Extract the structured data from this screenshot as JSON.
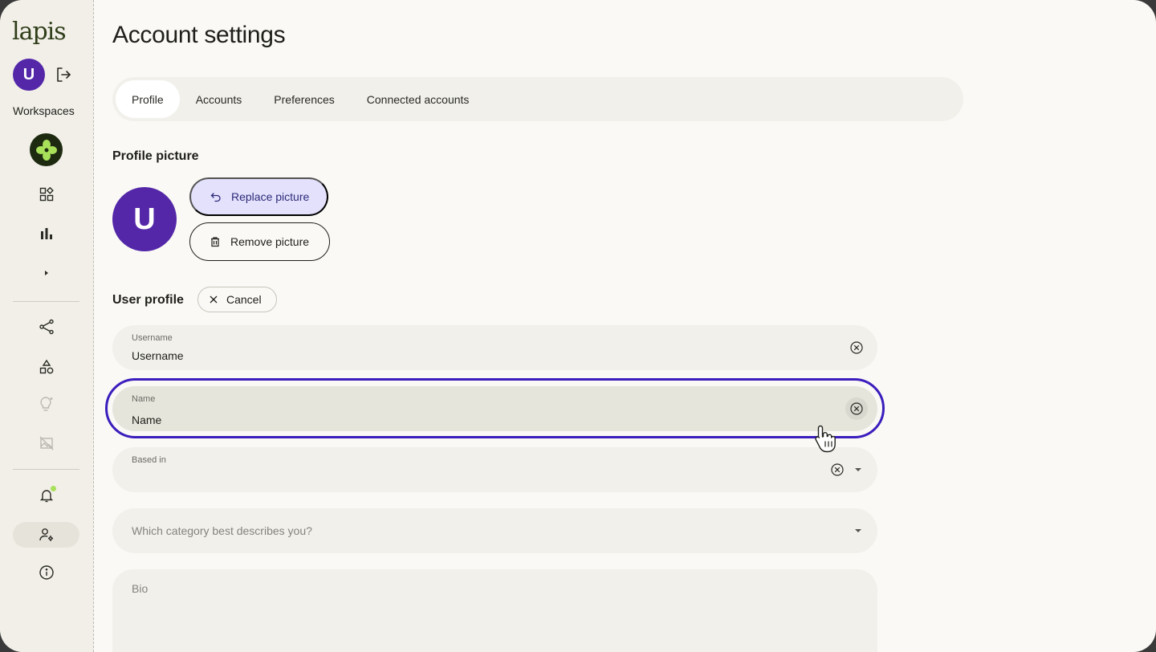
{
  "sidebar": {
    "logo": "lapis",
    "user_initial": "U",
    "workspaces_label": "Workspaces",
    "icons": [
      "logout-icon",
      "workspace-logo",
      "apps-icon",
      "bar-chart-icon",
      "chevron-right-icon",
      "share-icon",
      "shapes-icon",
      "lightbulb-icon",
      "image-slash-icon",
      "bell-icon",
      "user-settings-icon",
      "info-icon"
    ],
    "colors": {
      "avatar": "#5327a8",
      "workspace": "#1e2a10",
      "notification_dot": "#a8e05a"
    }
  },
  "page": {
    "title": "Account settings"
  },
  "tabs": [
    {
      "label": "Profile",
      "active": true
    },
    {
      "label": "Accounts",
      "active": false
    },
    {
      "label": "Preferences",
      "active": false
    },
    {
      "label": "Connected accounts",
      "active": false
    }
  ],
  "profile_picture": {
    "title": "Profile picture",
    "initial": "U",
    "replace_label": "Replace picture",
    "remove_label": "Remove picture"
  },
  "user_profile": {
    "title": "User profile",
    "cancel_label": "Cancel",
    "username": {
      "label": "Username",
      "value": "Username"
    },
    "name": {
      "label": "Name",
      "value": "Name"
    },
    "based_in": {
      "label": "Based in",
      "value": ""
    },
    "category": {
      "placeholder": "Which category best describes you?"
    },
    "bio": {
      "placeholder": "Bio"
    }
  },
  "accent_color": "#3b1dbd"
}
